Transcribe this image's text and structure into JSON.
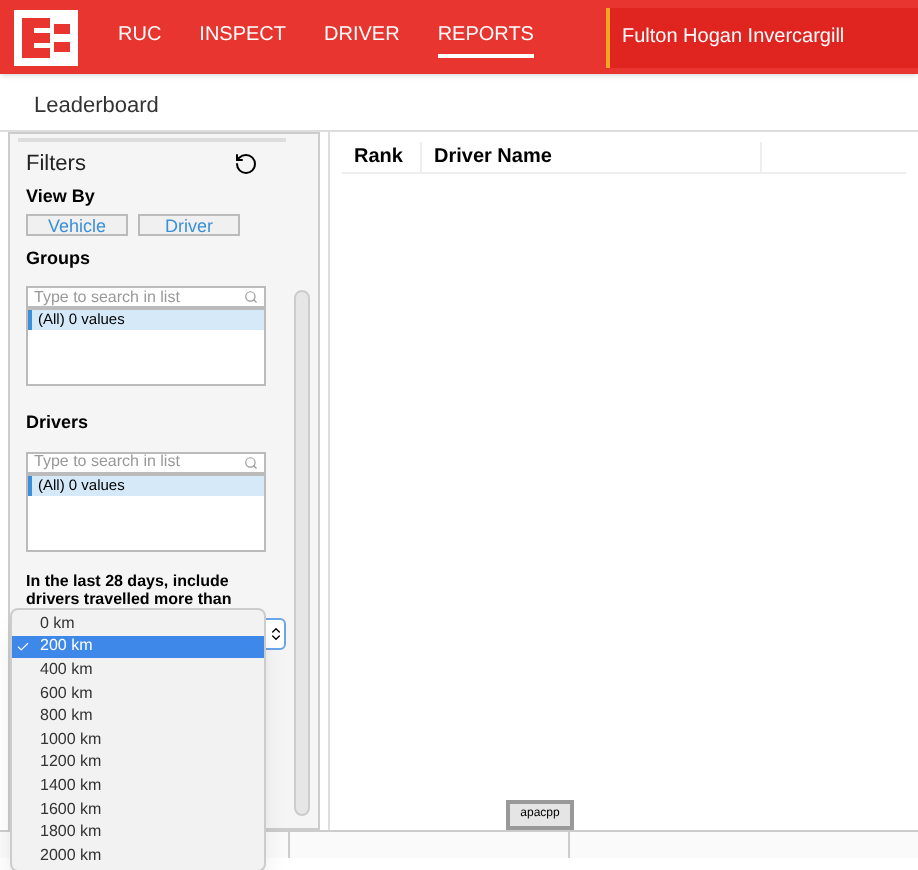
{
  "nav": {
    "items": [
      {
        "label": "RUC",
        "selected": false
      },
      {
        "label": "INSPECT",
        "selected": false
      },
      {
        "label": "DRIVER",
        "selected": false
      },
      {
        "label": "REPORTS",
        "selected": true
      }
    ],
    "organization": "Fulton Hogan Invercargill"
  },
  "page_title": "Leaderboard",
  "filters": {
    "title": "Filters",
    "view_by": {
      "label": "View By",
      "options": [
        {
          "label": "Vehicle"
        },
        {
          "label": "Driver"
        }
      ]
    },
    "lists": [
      {
        "label": "Groups",
        "placeholder": "Type to search in list",
        "items": [
          {
            "label": "(All) 0 values",
            "selected": true
          }
        ]
      },
      {
        "label": "Drivers",
        "placeholder": "Type to search in list",
        "items": [
          {
            "label": "(All) 0 values",
            "selected": true
          }
        ]
      }
    ],
    "distance": {
      "label": "In the last 28 days, include drivers travelled more than",
      "options": [
        {
          "label": "0 km",
          "selected": false
        },
        {
          "label": "200 km",
          "selected": true
        },
        {
          "label": "400 km",
          "selected": false
        },
        {
          "label": "600 km",
          "selected": false
        },
        {
          "label": "800 km",
          "selected": false
        },
        {
          "label": "1000 km",
          "selected": false
        },
        {
          "label": "1200 km",
          "selected": false
        },
        {
          "label": "1400 km",
          "selected": false
        },
        {
          "label": "1600 km",
          "selected": false
        },
        {
          "label": "1800 km",
          "selected": false
        },
        {
          "label": "2000 km",
          "selected": false
        }
      ]
    }
  },
  "table": {
    "columns": [
      "Rank",
      "Driver Name"
    ]
  },
  "tab_label": "apacpp"
}
